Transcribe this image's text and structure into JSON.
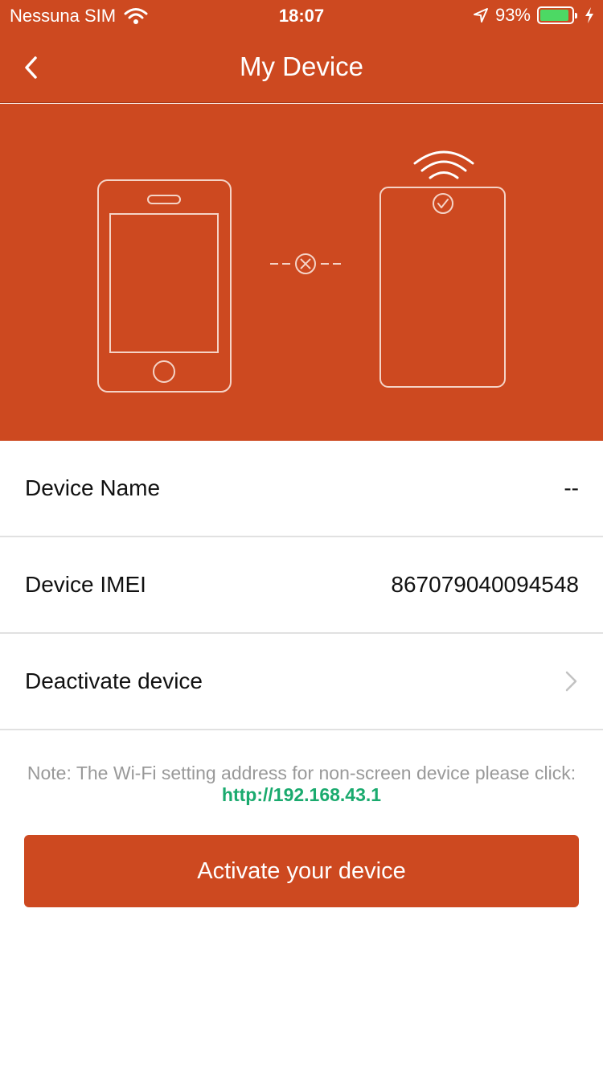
{
  "status_bar": {
    "carrier": "Nessuna SIM",
    "time": "18:07",
    "battery_percent": "93%",
    "battery_level": 0.93,
    "icons": [
      "wifi-icon",
      "location-arrow-icon",
      "battery-icon",
      "charging-bolt-icon"
    ]
  },
  "header": {
    "title": "My Device",
    "back_icon": "chevron-left-icon"
  },
  "hero": {
    "illustration": [
      "phone-icon",
      "disconnected-x-icon",
      "tablet-device-icon",
      "wifi-signal-icon",
      "check-circle-icon"
    ]
  },
  "rows": [
    {
      "label": "Device Name",
      "value": "--"
    },
    {
      "label": "Device IMEI",
      "value": "867079040094548"
    },
    {
      "label": "Deactivate device",
      "icon": "chevron-right-icon"
    }
  ],
  "note": {
    "text": "Note: The Wi-Fi setting address for non-screen device please click: ",
    "link": "http://192.168.43.1"
  },
  "activate_button": {
    "label": "Activate your device"
  },
  "colors": {
    "brand": "#cd4920",
    "link": "#1aaa6e",
    "divider": "#e1e1e1",
    "note_text": "#999999"
  }
}
